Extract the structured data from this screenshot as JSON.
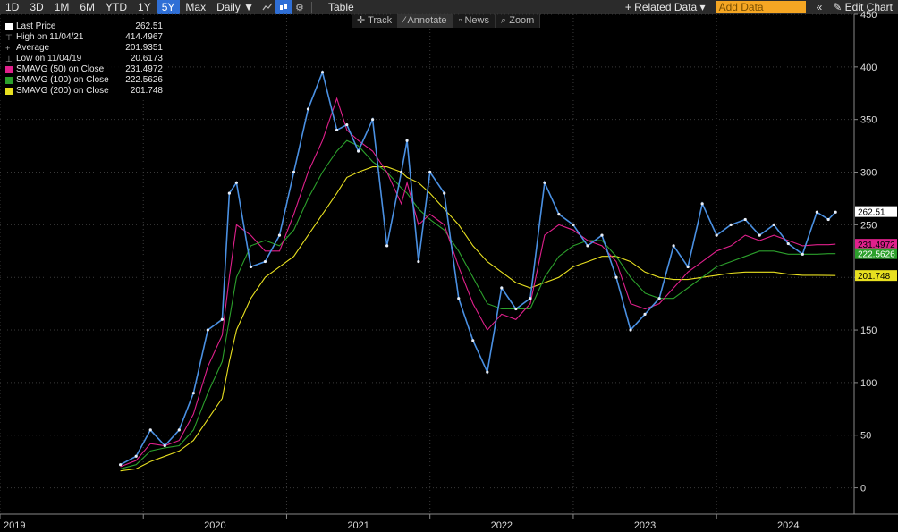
{
  "toolbar": {
    "ranges": [
      "1D",
      "3D",
      "1M",
      "6M",
      "YTD",
      "1Y",
      "5Y",
      "Max"
    ],
    "active_range": "5Y",
    "frequency": "Daily ▼",
    "table_label": "Table",
    "related_label": "+ Related Data ▾",
    "add_data_placeholder": "Add Data",
    "collapse_label": "«",
    "edit_chart_label": "✎ Edit Chart"
  },
  "subbar": [
    "Track",
    "Annotate",
    "News",
    "Zoom"
  ],
  "legend": [
    {
      "label": "Last Price",
      "value": "262.51",
      "color": "#ffffff"
    },
    {
      "label": "High on 11/04/21",
      "value": "414.4967",
      "color": ""
    },
    {
      "label": "Average",
      "value": "201.9351",
      "color": ""
    },
    {
      "label": "Low on 11/04/19",
      "value": "20.6173",
      "color": ""
    },
    {
      "label": "SMAVG (50)  on Close",
      "value": "231.4972",
      "color": "#e0208c"
    },
    {
      "label": "SMAVG (100)  on Close",
      "value": "222.5626",
      "color": "#2ca02c"
    },
    {
      "label": "SMAVG (200)  on Close",
      "value": "201.748",
      "color": "#e8e020"
    }
  ],
  "chart_data": {
    "type": "line",
    "ylim": [
      -25,
      450
    ],
    "yticks": [
      0,
      50,
      100,
      150,
      200,
      250,
      300,
      350,
      400,
      450
    ],
    "xticks": [
      "2019",
      "2020",
      "2021",
      "2022",
      "2023",
      "2024"
    ],
    "x": [
      2019.84,
      2019.95,
      2020.05,
      2020.15,
      2020.25,
      2020.35,
      2020.45,
      2020.55,
      2020.6,
      2020.65,
      2020.75,
      2020.85,
      2020.95,
      2021.05,
      2021.15,
      2021.25,
      2021.35,
      2021.42,
      2021.5,
      2021.6,
      2021.7,
      2021.8,
      2021.84,
      2021.92,
      2022.0,
      2022.1,
      2022.2,
      2022.3,
      2022.4,
      2022.5,
      2022.6,
      2022.7,
      2022.8,
      2022.9,
      2023.0,
      2023.1,
      2023.2,
      2023.3,
      2023.4,
      2023.5,
      2023.6,
      2023.7,
      2023.8,
      2023.9,
      2024.0,
      2024.1,
      2024.2,
      2024.3,
      2024.4,
      2024.5,
      2024.6,
      2024.7,
      2024.78,
      2024.83
    ],
    "series": [
      {
        "name": "Last Price",
        "color": "#4a90e2",
        "values": [
          22,
          30,
          55,
          40,
          55,
          90,
          150,
          160,
          280,
          290,
          210,
          215,
          240,
          300,
          360,
          395,
          340,
          345,
          320,
          350,
          230,
          300,
          330,
          215,
          300,
          280,
          180,
          140,
          110,
          190,
          170,
          180,
          290,
          260,
          250,
          230,
          240,
          200,
          150,
          165,
          180,
          230,
          210,
          270,
          240,
          250,
          255,
          240,
          250,
          232,
          222,
          262,
          255,
          262
        ]
      },
      {
        "name": "SMAVG (50)  on Close",
        "color": "#e0208c",
        "values": [
          20,
          26,
          42,
          40,
          45,
          70,
          115,
          145,
          200,
          250,
          240,
          225,
          225,
          260,
          300,
          330,
          370,
          340,
          330,
          320,
          300,
          270,
          290,
          250,
          260,
          250,
          210,
          175,
          150,
          165,
          160,
          175,
          240,
          250,
          245,
          235,
          230,
          215,
          175,
          170,
          175,
          190,
          205,
          215,
          225,
          230,
          240,
          235,
          240,
          235,
          230,
          231,
          231,
          231.5
        ]
      },
      {
        "name": "SMAVG (100)  on Close",
        "color": "#2ca02c",
        "values": [
          18,
          22,
          35,
          38,
          40,
          55,
          90,
          120,
          160,
          200,
          230,
          235,
          230,
          245,
          275,
          300,
          320,
          330,
          325,
          310,
          300,
          285,
          280,
          265,
          255,
          245,
          225,
          200,
          175,
          170,
          170,
          170,
          200,
          220,
          230,
          235,
          235,
          220,
          200,
          185,
          180,
          180,
          190,
          200,
          210,
          215,
          220,
          225,
          225,
          222,
          222,
          222,
          222.5,
          222.5
        ]
      },
      {
        "name": "SMAVG (200)  on Close",
        "color": "#e8e020",
        "values": [
          16,
          18,
          25,
          30,
          35,
          45,
          65,
          85,
          120,
          150,
          180,
          200,
          210,
          220,
          240,
          260,
          280,
          295,
          300,
          305,
          305,
          300,
          295,
          290,
          280,
          265,
          250,
          230,
          215,
          205,
          195,
          190,
          195,
          200,
          210,
          215,
          220,
          220,
          215,
          205,
          200,
          198,
          198,
          200,
          202,
          204,
          205,
          205,
          205,
          203,
          202,
          202,
          201.8,
          201.75
        ]
      }
    ],
    "last_labels": [
      {
        "text": "262.51",
        "value": 262.51,
        "bg": "#ffffff",
        "fg": "#000000"
      },
      {
        "text": "231.4972",
        "value": 231.4972,
        "bg": "#e0208c",
        "fg": "#000000"
      },
      {
        "text": "222.5626",
        "value": 222.5626,
        "bg": "#2ca02c",
        "fg": "#ffffff"
      },
      {
        "text": "201.748",
        "value": 201.748,
        "bg": "#e8e020",
        "fg": "#000000"
      }
    ]
  }
}
